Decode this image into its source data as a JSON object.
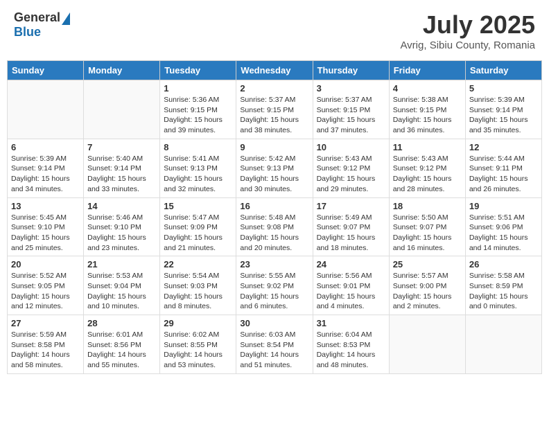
{
  "header": {
    "logo_general": "General",
    "logo_blue": "Blue",
    "month_year": "July 2025",
    "location": "Avrig, Sibiu County, Romania"
  },
  "days_of_week": [
    "Sunday",
    "Monday",
    "Tuesday",
    "Wednesday",
    "Thursday",
    "Friday",
    "Saturday"
  ],
  "weeks": [
    [
      {
        "num": "",
        "sunrise": "",
        "sunset": "",
        "daylight": ""
      },
      {
        "num": "",
        "sunrise": "",
        "sunset": "",
        "daylight": ""
      },
      {
        "num": "1",
        "sunrise": "Sunrise: 5:36 AM",
        "sunset": "Sunset: 9:15 PM",
        "daylight": "Daylight: 15 hours and 39 minutes."
      },
      {
        "num": "2",
        "sunrise": "Sunrise: 5:37 AM",
        "sunset": "Sunset: 9:15 PM",
        "daylight": "Daylight: 15 hours and 38 minutes."
      },
      {
        "num": "3",
        "sunrise": "Sunrise: 5:37 AM",
        "sunset": "Sunset: 9:15 PM",
        "daylight": "Daylight: 15 hours and 37 minutes."
      },
      {
        "num": "4",
        "sunrise": "Sunrise: 5:38 AM",
        "sunset": "Sunset: 9:15 PM",
        "daylight": "Daylight: 15 hours and 36 minutes."
      },
      {
        "num": "5",
        "sunrise": "Sunrise: 5:39 AM",
        "sunset": "Sunset: 9:14 PM",
        "daylight": "Daylight: 15 hours and 35 minutes."
      }
    ],
    [
      {
        "num": "6",
        "sunrise": "Sunrise: 5:39 AM",
        "sunset": "Sunset: 9:14 PM",
        "daylight": "Daylight: 15 hours and 34 minutes."
      },
      {
        "num": "7",
        "sunrise": "Sunrise: 5:40 AM",
        "sunset": "Sunset: 9:14 PM",
        "daylight": "Daylight: 15 hours and 33 minutes."
      },
      {
        "num": "8",
        "sunrise": "Sunrise: 5:41 AM",
        "sunset": "Sunset: 9:13 PM",
        "daylight": "Daylight: 15 hours and 32 minutes."
      },
      {
        "num": "9",
        "sunrise": "Sunrise: 5:42 AM",
        "sunset": "Sunset: 9:13 PM",
        "daylight": "Daylight: 15 hours and 30 minutes."
      },
      {
        "num": "10",
        "sunrise": "Sunrise: 5:43 AM",
        "sunset": "Sunset: 9:12 PM",
        "daylight": "Daylight: 15 hours and 29 minutes."
      },
      {
        "num": "11",
        "sunrise": "Sunrise: 5:43 AM",
        "sunset": "Sunset: 9:12 PM",
        "daylight": "Daylight: 15 hours and 28 minutes."
      },
      {
        "num": "12",
        "sunrise": "Sunrise: 5:44 AM",
        "sunset": "Sunset: 9:11 PM",
        "daylight": "Daylight: 15 hours and 26 minutes."
      }
    ],
    [
      {
        "num": "13",
        "sunrise": "Sunrise: 5:45 AM",
        "sunset": "Sunset: 9:10 PM",
        "daylight": "Daylight: 15 hours and 25 minutes."
      },
      {
        "num": "14",
        "sunrise": "Sunrise: 5:46 AM",
        "sunset": "Sunset: 9:10 PM",
        "daylight": "Daylight: 15 hours and 23 minutes."
      },
      {
        "num": "15",
        "sunrise": "Sunrise: 5:47 AM",
        "sunset": "Sunset: 9:09 PM",
        "daylight": "Daylight: 15 hours and 21 minutes."
      },
      {
        "num": "16",
        "sunrise": "Sunrise: 5:48 AM",
        "sunset": "Sunset: 9:08 PM",
        "daylight": "Daylight: 15 hours and 20 minutes."
      },
      {
        "num": "17",
        "sunrise": "Sunrise: 5:49 AM",
        "sunset": "Sunset: 9:07 PM",
        "daylight": "Daylight: 15 hours and 18 minutes."
      },
      {
        "num": "18",
        "sunrise": "Sunrise: 5:50 AM",
        "sunset": "Sunset: 9:07 PM",
        "daylight": "Daylight: 15 hours and 16 minutes."
      },
      {
        "num": "19",
        "sunrise": "Sunrise: 5:51 AM",
        "sunset": "Sunset: 9:06 PM",
        "daylight": "Daylight: 15 hours and 14 minutes."
      }
    ],
    [
      {
        "num": "20",
        "sunrise": "Sunrise: 5:52 AM",
        "sunset": "Sunset: 9:05 PM",
        "daylight": "Daylight: 15 hours and 12 minutes."
      },
      {
        "num": "21",
        "sunrise": "Sunrise: 5:53 AM",
        "sunset": "Sunset: 9:04 PM",
        "daylight": "Daylight: 15 hours and 10 minutes."
      },
      {
        "num": "22",
        "sunrise": "Sunrise: 5:54 AM",
        "sunset": "Sunset: 9:03 PM",
        "daylight": "Daylight: 15 hours and 8 minutes."
      },
      {
        "num": "23",
        "sunrise": "Sunrise: 5:55 AM",
        "sunset": "Sunset: 9:02 PM",
        "daylight": "Daylight: 15 hours and 6 minutes."
      },
      {
        "num": "24",
        "sunrise": "Sunrise: 5:56 AM",
        "sunset": "Sunset: 9:01 PM",
        "daylight": "Daylight: 15 hours and 4 minutes."
      },
      {
        "num": "25",
        "sunrise": "Sunrise: 5:57 AM",
        "sunset": "Sunset: 9:00 PM",
        "daylight": "Daylight: 15 hours and 2 minutes."
      },
      {
        "num": "26",
        "sunrise": "Sunrise: 5:58 AM",
        "sunset": "Sunset: 8:59 PM",
        "daylight": "Daylight: 15 hours and 0 minutes."
      }
    ],
    [
      {
        "num": "27",
        "sunrise": "Sunrise: 5:59 AM",
        "sunset": "Sunset: 8:58 PM",
        "daylight": "Daylight: 14 hours and 58 minutes."
      },
      {
        "num": "28",
        "sunrise": "Sunrise: 6:01 AM",
        "sunset": "Sunset: 8:56 PM",
        "daylight": "Daylight: 14 hours and 55 minutes."
      },
      {
        "num": "29",
        "sunrise": "Sunrise: 6:02 AM",
        "sunset": "Sunset: 8:55 PM",
        "daylight": "Daylight: 14 hours and 53 minutes."
      },
      {
        "num": "30",
        "sunrise": "Sunrise: 6:03 AM",
        "sunset": "Sunset: 8:54 PM",
        "daylight": "Daylight: 14 hours and 51 minutes."
      },
      {
        "num": "31",
        "sunrise": "Sunrise: 6:04 AM",
        "sunset": "Sunset: 8:53 PM",
        "daylight": "Daylight: 14 hours and 48 minutes."
      },
      {
        "num": "",
        "sunrise": "",
        "sunset": "",
        "daylight": ""
      },
      {
        "num": "",
        "sunrise": "",
        "sunset": "",
        "daylight": ""
      }
    ]
  ]
}
